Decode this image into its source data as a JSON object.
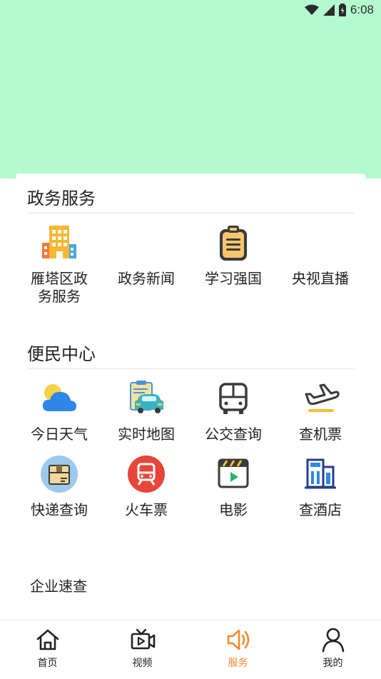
{
  "status_bar": {
    "time": "6:08"
  },
  "sections": [
    {
      "title": "政务服务",
      "items": [
        {
          "label_line1": "雁塔区政",
          "label_line2": "务服务",
          "icon": "building-icon"
        },
        {
          "label_line1": "政务新闻",
          "label_line2": "",
          "icon": ""
        },
        {
          "label_line1": "学习强国",
          "label_line2": "",
          "icon": "clipboard-icon"
        },
        {
          "label_line1": "央视直播",
          "label_line2": "",
          "icon": ""
        }
      ]
    },
    {
      "title": "便民中心",
      "items": [
        {
          "label": "今日天气",
          "icon": "weather-icon"
        },
        {
          "label": "实时地图",
          "icon": "map-car-icon"
        },
        {
          "label": "公交查询",
          "icon": "bus-icon"
        },
        {
          "label": "查机票",
          "icon": "airplane-icon"
        },
        {
          "label": "快递查询",
          "icon": "package-icon"
        },
        {
          "label": "火车票",
          "icon": "train-icon"
        },
        {
          "label": "电影",
          "icon": "movie-icon"
        },
        {
          "label": "查酒店",
          "icon": "hotel-icon"
        }
      ]
    }
  ],
  "enterprise_label": "企业速查",
  "tabbar": [
    {
      "label": "首页",
      "icon": "home-icon",
      "active": false
    },
    {
      "label": "视频",
      "icon": "video-icon",
      "active": false
    },
    {
      "label": "服务",
      "icon": "speaker-icon",
      "active": true
    },
    {
      "label": "我的",
      "icon": "user-icon",
      "active": false
    }
  ],
  "colors": {
    "hero_bg": "#b5f9d0",
    "active_tab": "#f28a30"
  }
}
